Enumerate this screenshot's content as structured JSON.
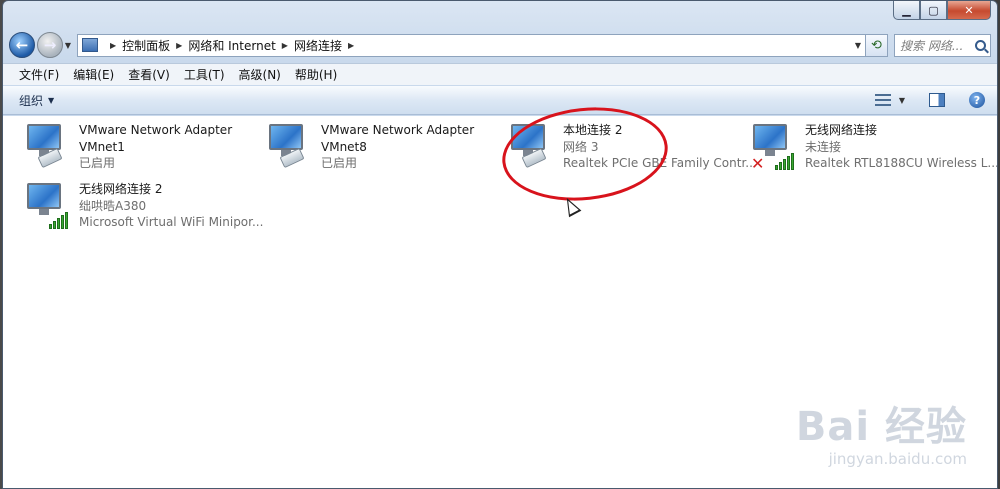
{
  "address": {
    "crumbs": [
      "控制面板",
      "网络和 Internet",
      "网络连接"
    ]
  },
  "search": {
    "placeholder": "搜索 网络..."
  },
  "menu": [
    "文件(F)",
    "编辑(E)",
    "查看(V)",
    "工具(T)",
    "高级(N)",
    "帮助(H)"
  ],
  "commandbar": {
    "organize_label": "组织"
  },
  "connections": [
    {
      "name": "VMware Network Adapter",
      "name2": "VMnet1",
      "status": "已启用",
      "device": "",
      "type": "wired"
    },
    {
      "name": "VMware Network Adapter",
      "name2": "VMnet8",
      "status": "已启用",
      "device": "",
      "type": "wired"
    },
    {
      "name": "本地连接 2",
      "name2": "",
      "status": "网络  3",
      "device": "Realtek PCIe GBE Family Contr...",
      "type": "wired"
    },
    {
      "name": "无线网络连接",
      "name2": "",
      "status": "未连接",
      "device": "Realtek RTL8188CU Wireless L...",
      "type": "wireless-disconnected"
    },
    {
      "name": "无线网络连接 2",
      "name2": "",
      "status": "绌哄晧A380",
      "device": "Microsoft Virtual WiFi Minipor...",
      "type": "wireless"
    }
  ],
  "watermark": {
    "brand": "Bai 经验",
    "url": "jingyan.baidu.com"
  },
  "colors": {
    "highlight": "#d8131c",
    "signal": "#39a832",
    "disconnected": "#d32020"
  }
}
